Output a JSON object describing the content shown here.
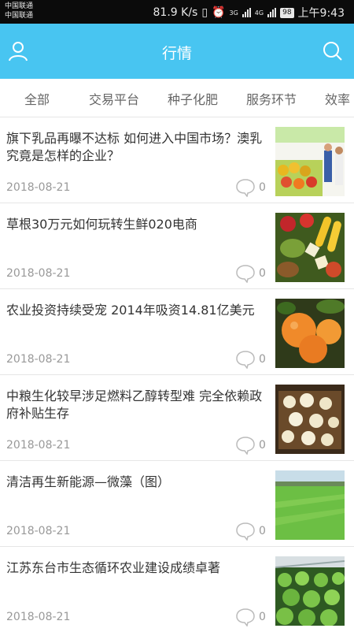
{
  "status_bar": {
    "carrier_1": "中国联通",
    "carrier_2": "中国联通",
    "speed": "81.9 K/s",
    "network_1": "3G",
    "network_2": "4G",
    "battery": "98",
    "time": "上午9:43"
  },
  "header": {
    "title": "行情"
  },
  "tabs": [
    {
      "label": "全部"
    },
    {
      "label": "交易平台"
    },
    {
      "label": "种子化肥"
    },
    {
      "label": "服务环节"
    },
    {
      "label": "效率"
    }
  ],
  "articles": [
    {
      "title": "旗下乳品再曝不达标 如何进入中国市场？澳乳究竟是怎样的企业？",
      "date": "2018-08-21",
      "comments": "0",
      "image": "fruit-market-photo"
    },
    {
      "title": "草根30万元如何玩转生鲜020电商",
      "date": "2018-08-21",
      "comments": "0",
      "image": "fresh-produce-photo"
    },
    {
      "title": "农业投资持续受宠 2014年吸资14.81亿美元",
      "date": "2018-08-21",
      "comments": "0",
      "image": "oranges-photo"
    },
    {
      "title": "中粮生化较早涉足燃料乙醇转型难 完全依赖政府补贴生存",
      "date": "2018-08-21",
      "comments": "0",
      "image": "mushroom-crate-photo"
    },
    {
      "title": "清洁再生新能源—微藻（图）",
      "date": "2018-08-21",
      "comments": "0",
      "image": "green-field-photo"
    },
    {
      "title": "江苏东台市生态循环农业建设成绩卓著",
      "date": "2018-08-21",
      "comments": "0",
      "image": "greenhouse-lettuce-photo"
    }
  ],
  "colors": {
    "header": "#48c5f1",
    "status_bar": "#0b0b0b",
    "tab_text": "#666666",
    "date_text": "#999999"
  }
}
